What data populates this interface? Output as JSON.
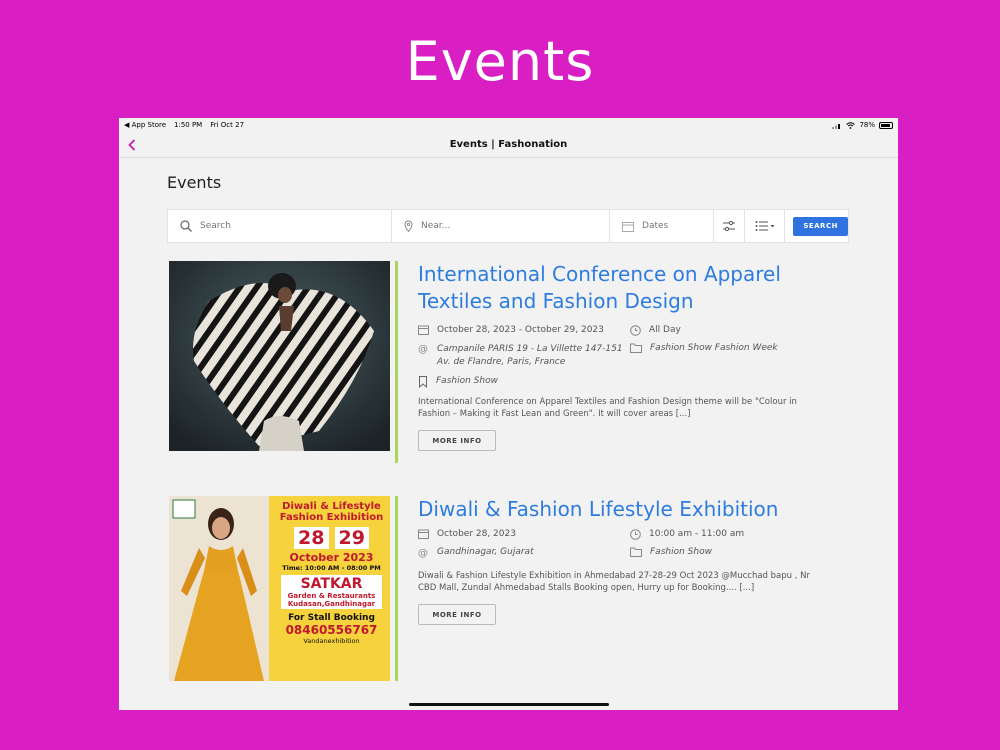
{
  "promo": {
    "title": "Events"
  },
  "status_bar": {
    "back_app": "◀ App Store",
    "time": "1:50 PM",
    "date": "Fri Oct 27",
    "battery": "78%"
  },
  "navbar": {
    "title": "Events | Fashonation"
  },
  "page": {
    "heading": "Events"
  },
  "search": {
    "search_placeholder": "Search",
    "near_placeholder": "Near...",
    "dates_placeholder": "Dates",
    "button_label": "SEARCH"
  },
  "events": [
    {
      "title": "International Conference on Apparel Textiles and Fashion Design",
      "date": "October 28, 2023 - October 29, 2023",
      "time": "All Day",
      "location": "Campanile PARIS 19 - La Villette 147-151 Av. de Flandre, Paris, France",
      "categories": "Fashion Show  Fashion Week",
      "tag": "Fashion Show",
      "description": "International Conference on Apparel Textiles and Fashion Design theme will be \"Colour in Fashion – Making it Fast Lean and Green\". It will cover areas [...]",
      "more_label": "MORE INFO"
    },
    {
      "title": "Diwali & Fashion Lifestyle Exhibition",
      "date": "October 28, 2023",
      "time": "10:00 am - 11:00 am",
      "location": "Gandhinagar, Gujarat",
      "categories": "Fashion Show",
      "description": "Diwali & Fashion Lifestyle Exhibition in Ahmedabad 27-28-29 Oct 2023 @Mucchad bapu , Nr CBD Mall, Zundal Ahmedabad Stalls Booking open, Hurry up for Booking.... [...]",
      "more_label": "MORE INFO"
    }
  ],
  "poster": {
    "headline1": "Diwali & Lifestyle",
    "headline2": "Fashion Exhibition",
    "day1": "28",
    "day2": "29",
    "month": "October 2023",
    "time": "Time: 10:00 AM - 08:00 PM",
    "venue1": "SATKAR",
    "venue2": "Garden & Restaurants",
    "venue3": "Kudasan,Gandhinagar",
    "booking": "For Stall Booking",
    "phone": "08460556767",
    "handle": "Vandanexhibition"
  },
  "colors": {
    "background": "#d91ec4",
    "accent": "#2e7ce0",
    "bar": "#a8d65a",
    "button": "#2f73e0"
  }
}
